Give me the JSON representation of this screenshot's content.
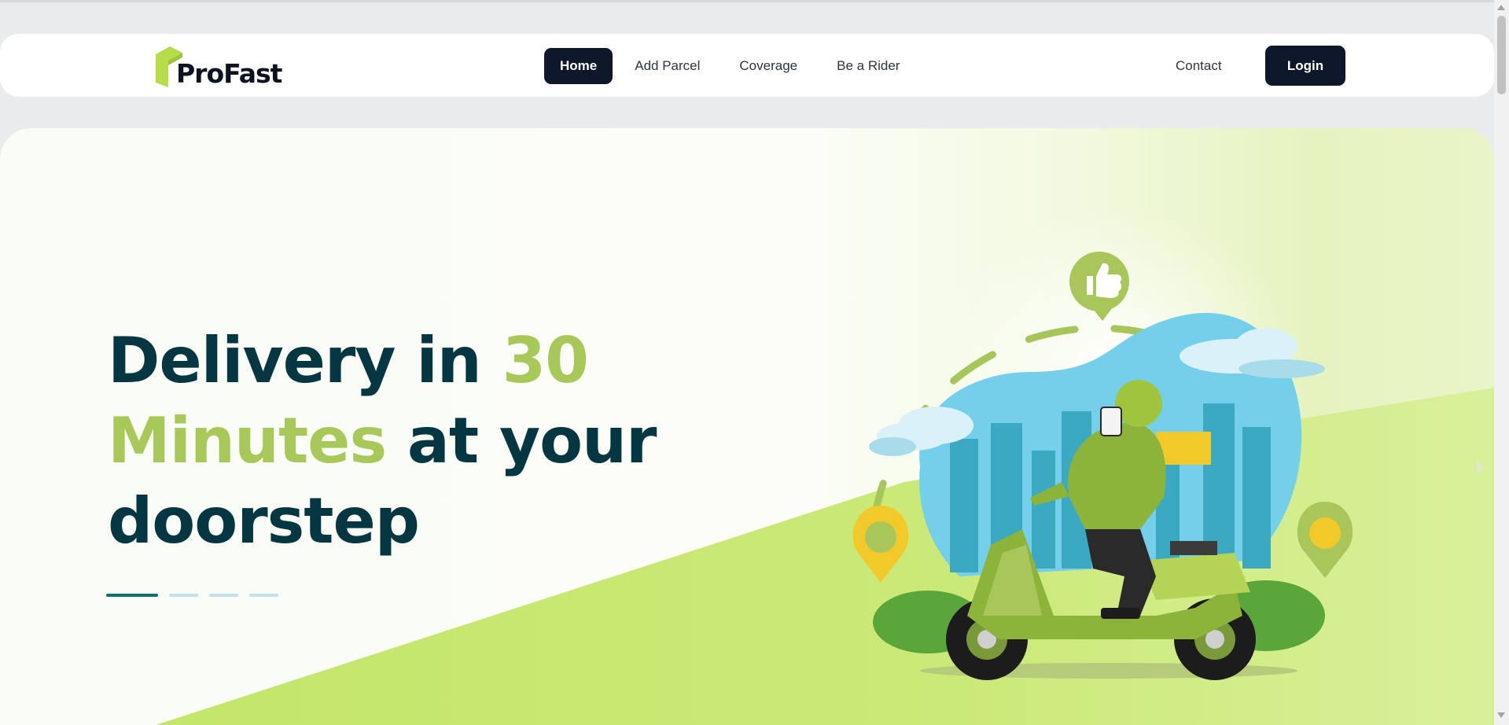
{
  "brand": {
    "name": "ProFast",
    "accent_color": "#b5dd4a",
    "dark_color": "#0f172a"
  },
  "nav": {
    "links": [
      {
        "label": "Home",
        "active": true
      },
      {
        "label": "Add Parcel",
        "active": false
      },
      {
        "label": "Coverage",
        "active": false
      },
      {
        "label": "Be a Rider",
        "active": false
      }
    ],
    "contact_label": "Contact",
    "login_label": "Login"
  },
  "hero": {
    "headline_part1": "Delivery in ",
    "headline_accent1": "30",
    "headline_accent2": "Minutes",
    "headline_part2": " at your",
    "headline_part3": "doorstep",
    "slides_total": 4,
    "active_slide": 1,
    "illustration_icon": "delivery-rider-illustration"
  }
}
